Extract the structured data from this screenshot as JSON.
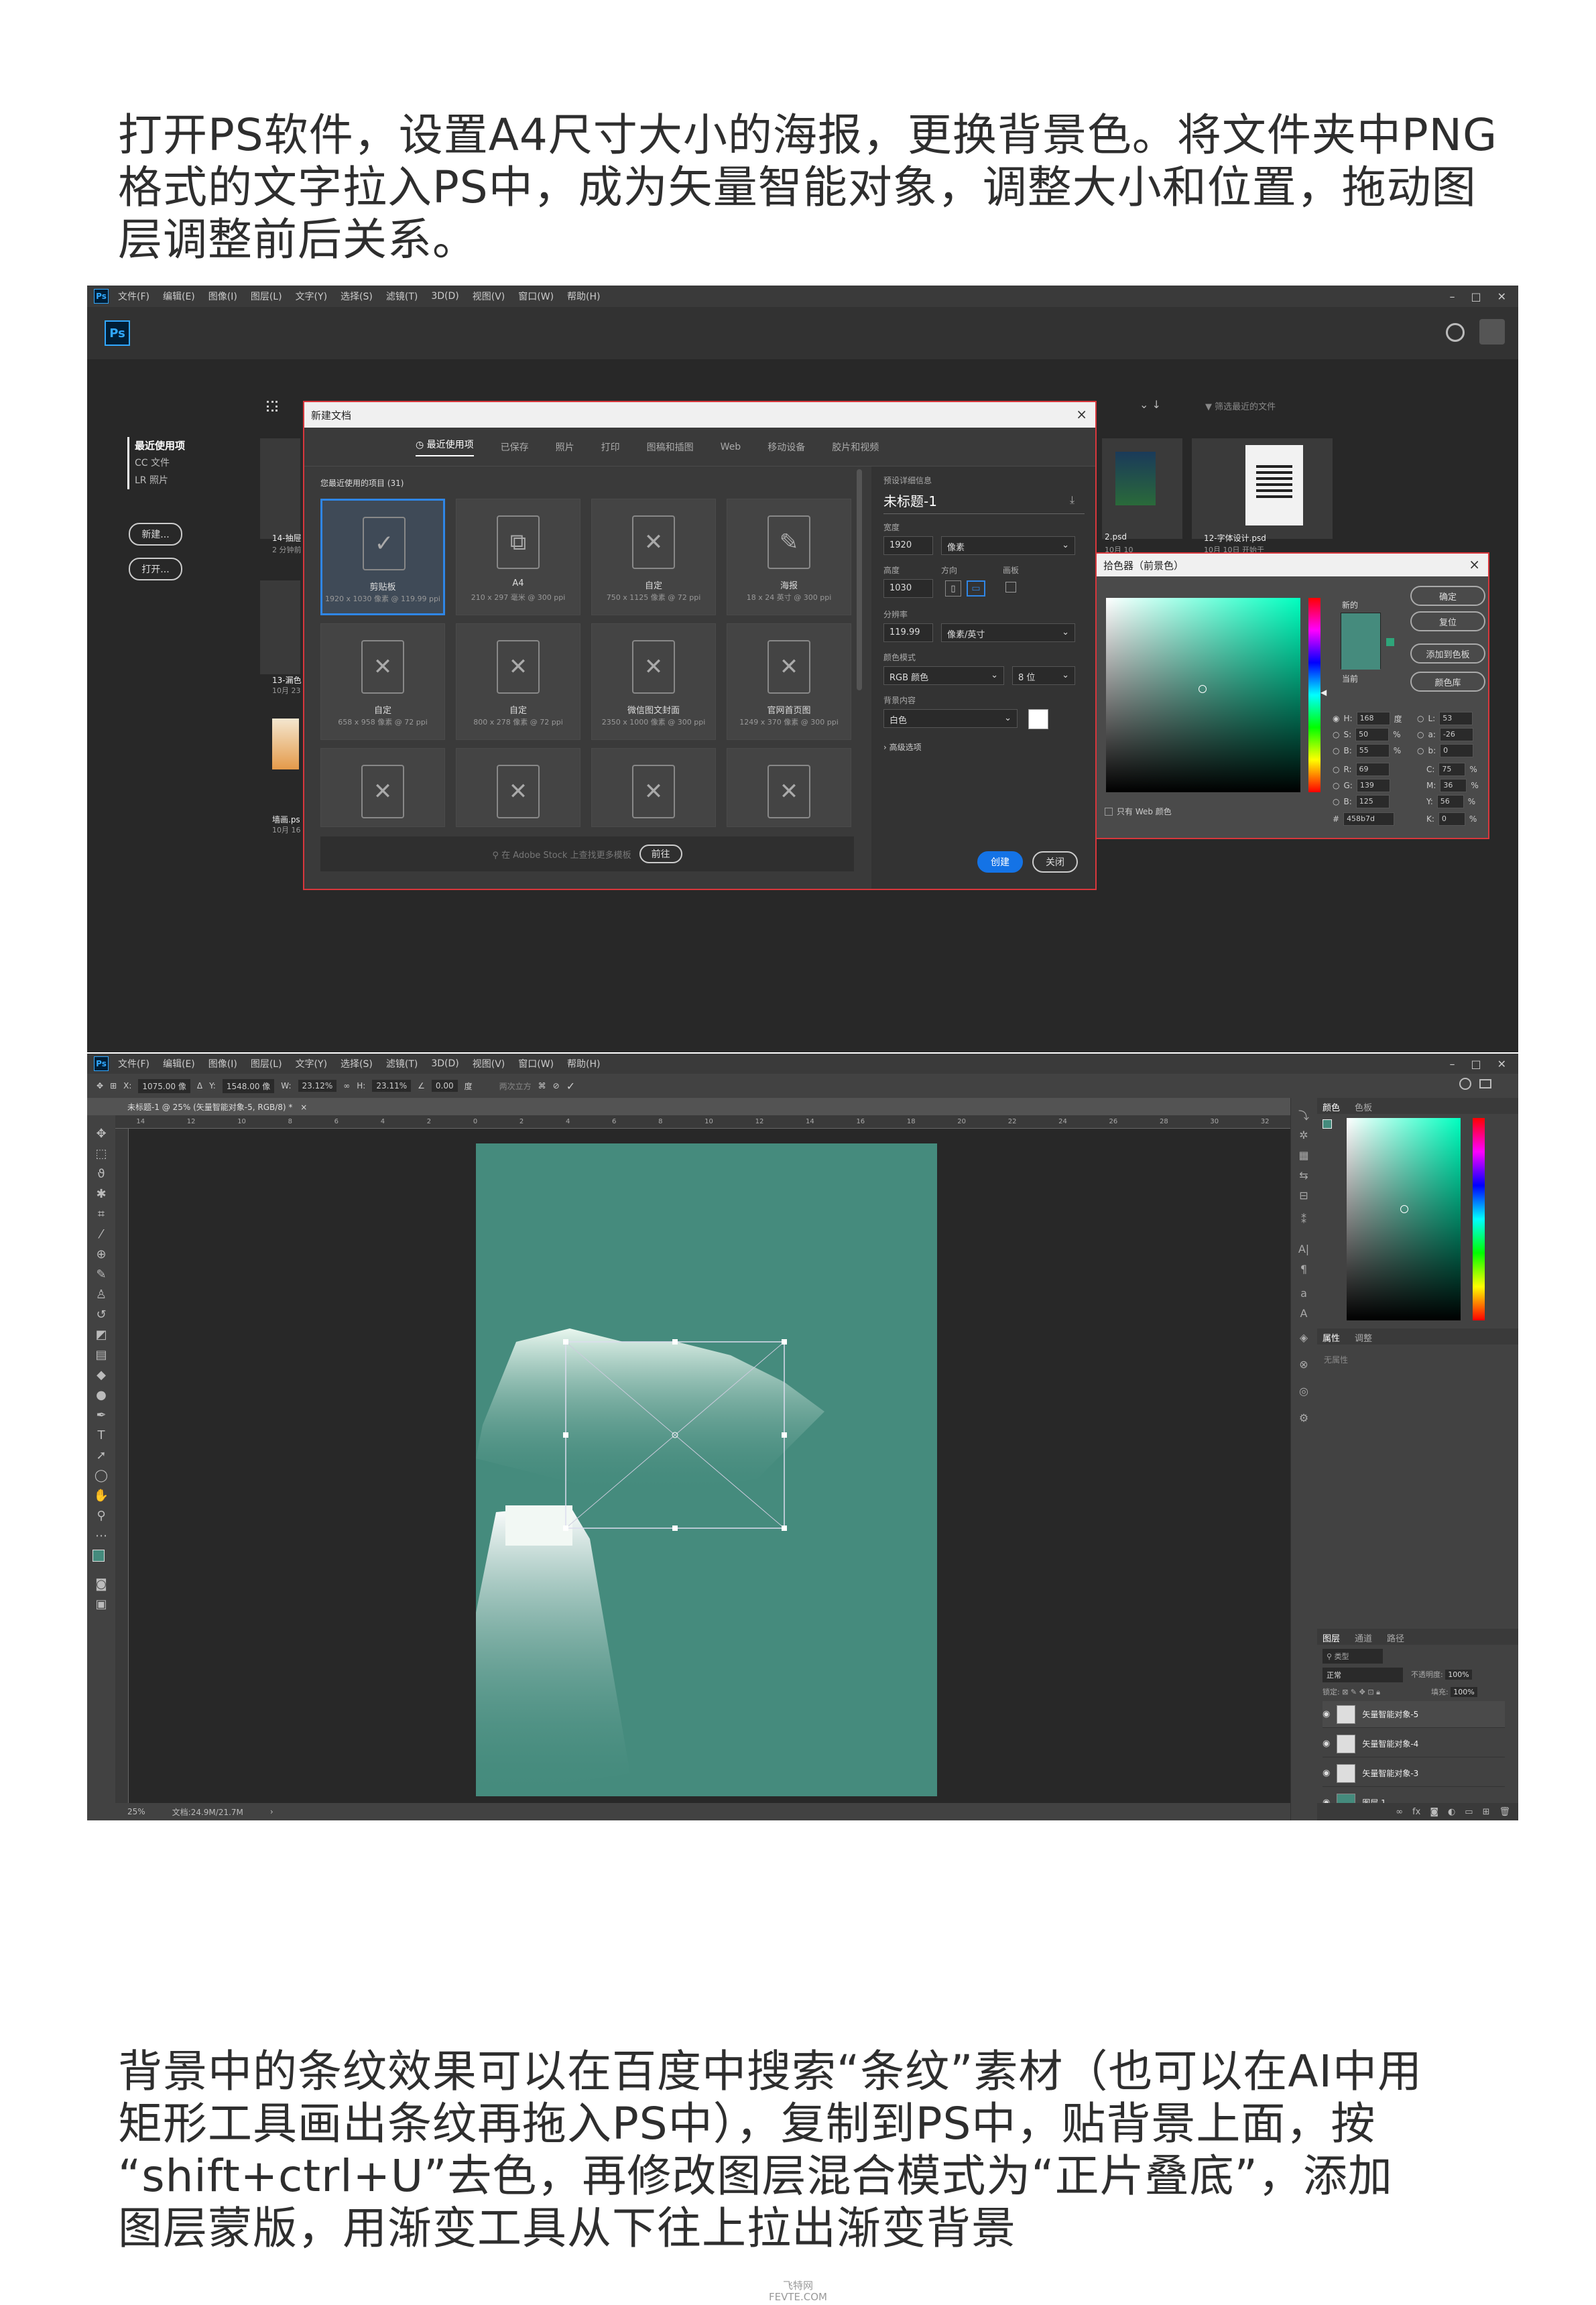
{
  "paragraph1": {
    "lines": [
      "打开PS软件，设置A4尺寸大小的海报，更换背景色。将文件夹中PNG",
      "格式的文字拉入PS中，成为矢量智能对象，调整大小和位置，拖动图",
      "层调整前后关系。"
    ]
  },
  "paragraph2": {
    "lines": [
      "背景中的条纹效果可以在百度中搜索“条纹”素材（也可以在AI中用",
      "矩形工具画出条纹再拖入PS中），复制到PS中，贴背景上面，按",
      "“shift+ctrl+U”去色，再修改图层混合模式为“正片叠底”，添加",
      "图层蒙版，用渐变工具从下往上拉出渐变背景"
    ]
  },
  "footer": {
    "line1": "飞特网",
    "line2": "FEVTE.COM"
  },
  "ps_menu": [
    "文件(F)",
    "编辑(E)",
    "图像(I)",
    "图层(L)",
    "文字(Y)",
    "选择(S)",
    "滤镜(T)",
    "3D(D)",
    "视图(V)",
    "窗口(W)",
    "帮助(H)"
  ],
  "window_controls": {
    "minimize": "–",
    "maximize": "□",
    "close": "✕"
  },
  "ps_logo": "Ps",
  "start": {
    "nav": [
      "最近使用项",
      "CC 文件",
      "LR 照片"
    ],
    "create_button": "新建...",
    "open_button": "打开...",
    "filter_placeholder": "筛选最近的文件",
    "recent_files": [
      {
        "name": "14-抽屉",
        "sub": "2 分钟前"
      },
      {
        "name": "13-漏色",
        "sub": "10月 23"
      },
      {
        "name": "墙画.ps",
        "sub": "10月 16"
      },
      {
        "name": "2.psd",
        "sub": "10月 10"
      },
      {
        "name": "12-字体设计.psd",
        "sub": "10月 10日  开始于"
      }
    ]
  },
  "new_doc": {
    "title": "新建文档",
    "tabs": [
      "最近使用项",
      "已保存",
      "照片",
      "打印",
      "图稿和插图",
      "Web",
      "移动设备",
      "胶片和视频"
    ],
    "section_label": "您最近使用的项目",
    "section_count": "(31)",
    "presets": [
      {
        "name": "剪贴板",
        "size": "1920 x 1030 像素 @ 119.99 ppi"
      },
      {
        "name": "A4",
        "size": "210 x 297 毫米 @ 300 ppi"
      },
      {
        "name": "自定",
        "size": "750 x 1125 像素 @ 72 ppi"
      },
      {
        "name": "海报",
        "size": "18 x 24 英寸 @ 300 ppi"
      },
      {
        "name": "自定",
        "size": "658 x 958 像素 @ 72 ppi"
      },
      {
        "name": "自定",
        "size": "800 x 278 像素 @ 72 ppi"
      },
      {
        "name": "微信图文封面",
        "size": "2350 x 1000 像素 @ 300 ppi"
      },
      {
        "name": "官网首页图",
        "size": "1249 x 370 像素 @ 300 ppi"
      },
      {
        "name": "",
        "size": ""
      },
      {
        "name": "",
        "size": ""
      },
      {
        "name": "",
        "size": ""
      },
      {
        "name": "",
        "size": ""
      }
    ],
    "stock_placeholder": "在 Adobe Stock 上查找更多模板",
    "go_button": "前往",
    "details_label": "预设详细信息",
    "doc_name": "未标题-1",
    "width_label": "宽度",
    "width_value": "1920",
    "width_unit": "像素",
    "height_label": "高度",
    "orient_label": "方向",
    "artboard_label": "画板",
    "height_value": "1030",
    "resolution_label": "分辨率",
    "resolution_value": "119.99",
    "resolution_unit": "像素/英寸",
    "color_mode_label": "颜色模式",
    "color_mode": "RGB 颜色",
    "bit_depth": "8 位",
    "background_label": "背景内容",
    "background": "白色",
    "advanced": "高级选项",
    "create_button": "创建",
    "close_button": "关闭"
  },
  "color_picker": {
    "title": "拾色器（前景色）",
    "new_label": "新的",
    "current_label": "当前",
    "buttons": [
      "确定",
      "复位",
      "添加到色板",
      "颜色库"
    ],
    "web_only": "只有 Web 颜色",
    "color": "#458b7d",
    "left_fields": [
      {
        "label": "H:",
        "value": "168",
        "unit": "度"
      },
      {
        "label": "S:",
        "value": "50",
        "unit": "%"
      },
      {
        "label": "B:",
        "value": "55",
        "unit": "%"
      },
      {
        "label": "R:",
        "value": "69",
        "unit": ""
      },
      {
        "label": "G:",
        "value": "139",
        "unit": ""
      },
      {
        "label": "B:",
        "value": "125",
        "unit": ""
      }
    ],
    "right_fields": [
      {
        "label": "L:",
        "value": "53",
        "unit": ""
      },
      {
        "label": "a:",
        "value": "-26",
        "unit": ""
      },
      {
        "label": "b:",
        "value": "0",
        "unit": ""
      },
      {
        "label": "C:",
        "value": "75",
        "unit": "%"
      },
      {
        "label": "M:",
        "value": "36",
        "unit": "%"
      },
      {
        "label": "Y:",
        "value": "56",
        "unit": "%"
      },
      {
        "label": "K:",
        "value": "0",
        "unit": "%"
      }
    ],
    "hex_label": "#",
    "hex": "458b7d"
  },
  "editor": {
    "options": {
      "x_label": "X:",
      "x": "1075.00 像",
      "y_label": "Y:",
      "y": "1548.00 像",
      "w_label": "W:",
      "w": "23.12%",
      "h_label": "H:",
      "h": "23.11%",
      "angle": "0.00",
      "angle_unit": "度",
      "interp": "两次立方"
    },
    "doc_tab": "未标题-1 @ 25% (矢量智能对象-5, RGB/8) *",
    "tab_close": "×",
    "ruler_numbers": [
      "14",
      "12",
      "10",
      "8",
      "6",
      "4",
      "2",
      "0",
      "2",
      "4",
      "6",
      "8",
      "10",
      "12",
      "14",
      "16",
      "18",
      "20",
      "22",
      "24",
      "26",
      "28",
      "30",
      "32"
    ],
    "canvas_bg": "#458b7d",
    "status_zoom": "25%",
    "status_doc": "文档:24.9M/21.7M",
    "color_tabs": [
      "颜色",
      "色板"
    ],
    "props_tabs": [
      "属性",
      "调整"
    ],
    "props_empty": "无属性",
    "layers_tabs": [
      "图层",
      "通道",
      "路径"
    ],
    "kind_label": "类型",
    "blend_mode": "正常",
    "opacity_label": "不透明度:",
    "opacity_value": "100%",
    "lock_label": "锁定:",
    "fill_label": "填充:",
    "fill_value": "100%",
    "layers": [
      {
        "name": "矢量智能对象-5",
        "selected": true
      },
      {
        "name": "矢量智能对象-4",
        "selected": false
      },
      {
        "name": "矢量智能对象-3",
        "selected": false
      },
      {
        "name": "图层 1",
        "selected": false
      }
    ]
  }
}
